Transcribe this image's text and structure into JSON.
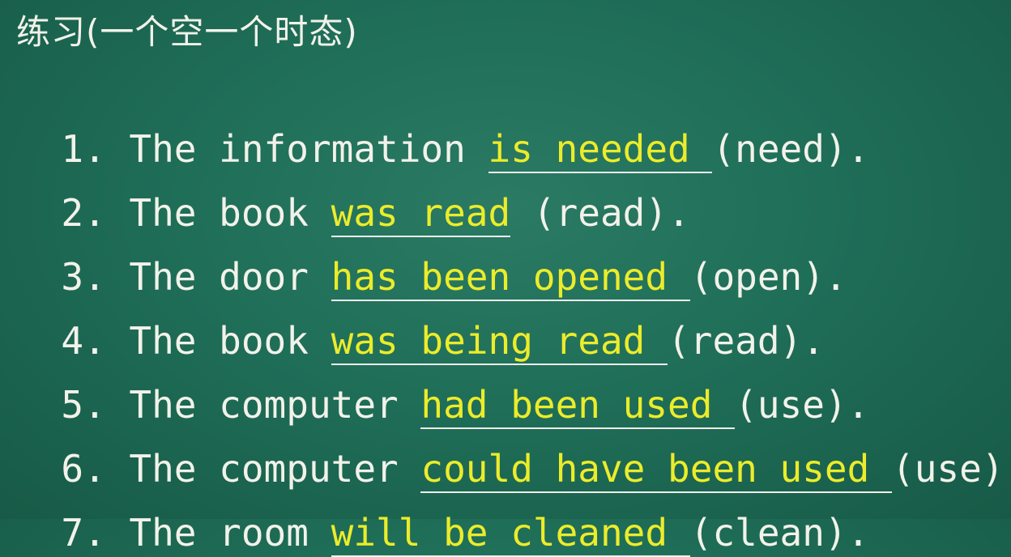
{
  "title": "练习(一个空一个时态)",
  "items": [
    {
      "num": "1.",
      "lead": "The information ",
      "answer": "is needed ",
      "hint": "(need)."
    },
    {
      "num": "2.",
      "lead": "The book ",
      "answer": "was read",
      "hint": " (read)."
    },
    {
      "num": "3.",
      "lead": "The door ",
      "answer": "has been opened ",
      "hint": "(open)."
    },
    {
      "num": "4.",
      "lead": "The book ",
      "answer": "was being read ",
      "hint": "(read)."
    },
    {
      "num": "5.",
      "lead": "The computer ",
      "answer": "had been used ",
      "hint": "(use)."
    },
    {
      "num": "6.",
      "lead": "The computer ",
      "answer": "could have been used ",
      "hint": "(use)."
    },
    {
      "num": "7.",
      "lead": "The room ",
      "answer": "will be cleaned ",
      "hint": "(clean)."
    }
  ],
  "colors": {
    "background": "#1f6e58",
    "text": "#f2f2ea",
    "answer": "#ecec2a"
  }
}
